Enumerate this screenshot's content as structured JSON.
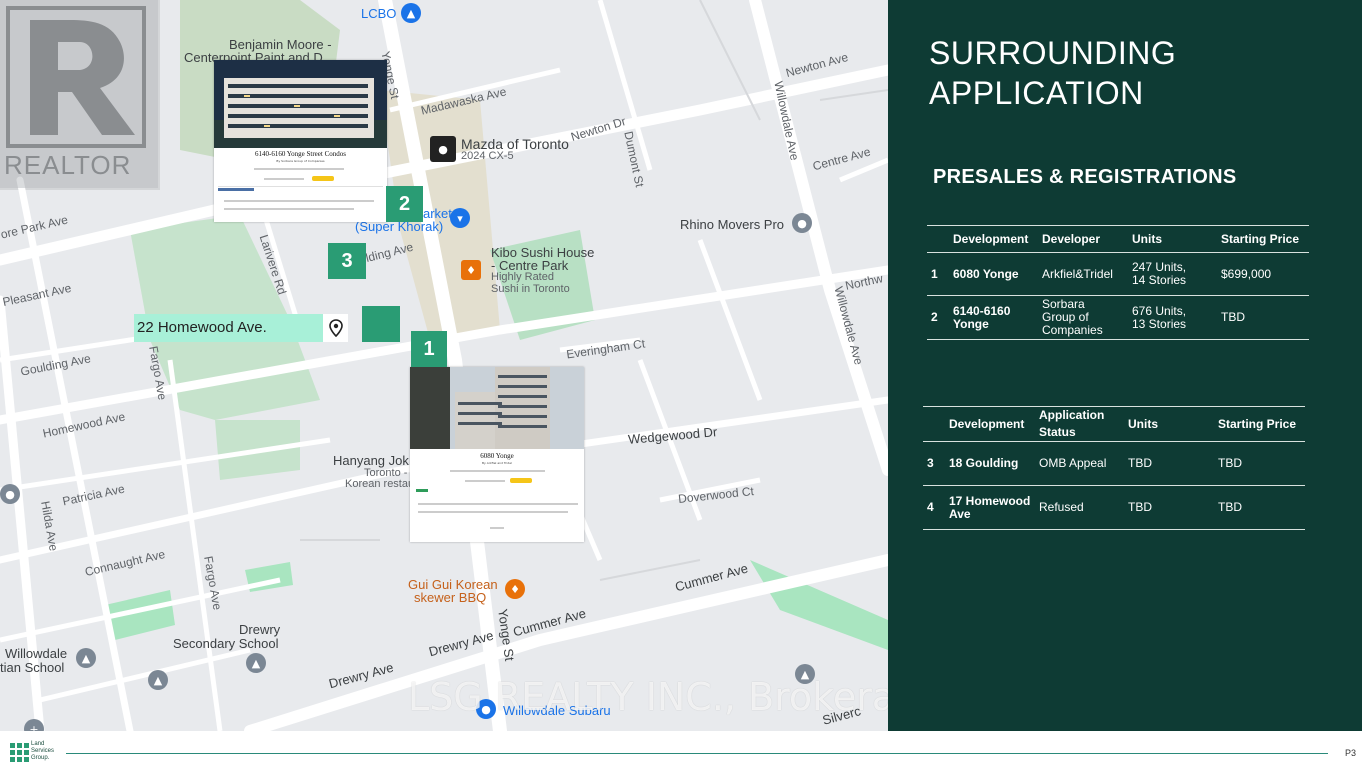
{
  "map": {
    "streets": {
      "yonge": "Yonge St",
      "madawaska": "Madawaska Ave",
      "newton_dr": "Newton Dr",
      "newton_ave": "Newton Ave",
      "dumont": "Dumont St",
      "willowdale": "Willowdale Ave",
      "centre": "Centre Ave",
      "northwest": "Northw",
      "park": "ore Park Ave",
      "pleasant": "Pleasant Ave",
      "goulding": "Goulding Ave",
      "goulding2": "oulding Ave",
      "larivere": "Larivere Rd",
      "fargo1": "Fargo Ave",
      "fargo2": "Fargo Ave",
      "homewood": "Homewood Ave",
      "patricia": "Patricia Ave",
      "hilda": "Hilda Ave",
      "connaught": "Connaught Ave",
      "everingham": "Everingham Ct",
      "wedgewood": "Wedgewood Dr",
      "doverwood": "Doverwood Ct",
      "cummer1": "Cummer Ave",
      "cummer2": "Cummer Ave",
      "drewry1": "Drewry Ave",
      "drewry2": "Drewry Ave",
      "yonge2": "Yonge St",
      "silver": "Silverc"
    },
    "pois": {
      "lcbo": "LCBO",
      "benjamin1": "Benjamin Moore -",
      "benjamin2": "Centerpoint Paint and D",
      "mazda": "Mazda of Toronto",
      "mazda_sub": "2024 CX-5",
      "market1": "arket",
      "market2": "(Super Khorak)",
      "kibo1": "Kibo Sushi House",
      "kibo2": "- Centre Park",
      "kibo3": "Highly Rated",
      "kibo4": "Sushi in Toronto",
      "rhino": "Rhino Movers Pro",
      "hanyang1": "Hanyang Jok",
      "hanyang2": "Toronto -",
      "hanyang3": "Korean restau",
      "gugui1": "Gui Gui Korean",
      "gugui2": "skewer BBQ",
      "drewry_school1": "Drewry",
      "drewry_school2": "Secondary School",
      "willowdale1": "Willowdale",
      "willowdale2": "tian School",
      "subaru": "Willowdale Subaru"
    },
    "realtor": "REALTOR",
    "address": "22 Homewood Ave.",
    "markers": [
      "2",
      "3",
      "1"
    ],
    "card2": {
      "title": "6140-6160 Yonge Street Condos",
      "subtitle": "By Sorbara Group of Companies"
    },
    "card1": {
      "title": "6080 Yonge",
      "subtitle": "By Arkfiel and Tridel"
    },
    "watermark": "LSG REALTY INC., Brokerage"
  },
  "panel": {
    "title_line1": "SURROUNDING",
    "title_line2": "APPLICATION",
    "subtitle": "PRESALES & REGISTRATIONS",
    "table1": {
      "headers": [
        "Development",
        "Developer",
        "Units",
        "Starting Price"
      ],
      "rows": [
        {
          "num": "1",
          "dev": "6080 Yonge",
          "developer": "Arkfiel&Tridel",
          "units": "247 Units, 14 Stories",
          "price": "$699,000"
        },
        {
          "num": "2",
          "dev": "6140-6160 Yonge",
          "developer": "Sorbara Group of Companies",
          "units": "676 Units, 13 Stories",
          "price": "TBD"
        }
      ]
    },
    "table2": {
      "headers": [
        "Development",
        "Application Status",
        "Units",
        "Starting Price"
      ],
      "rows": [
        {
          "num": "3",
          "dev": "18 Goulding",
          "status": "OMB Appeal",
          "units": "TBD",
          "price": "TBD"
        },
        {
          "num": "4",
          "dev": "17 Homewood Ave",
          "status": "Refused",
          "units": "TBD",
          "price": "TBD"
        }
      ]
    }
  },
  "footer": {
    "logo_line1": "Land",
    "logo_line2": "Services",
    "logo_line3": "Group.",
    "page": "P3"
  },
  "colors": {
    "panel": "#0e3b34",
    "marker": "#2a9c74",
    "address_bg": "#a8f0d8"
  }
}
